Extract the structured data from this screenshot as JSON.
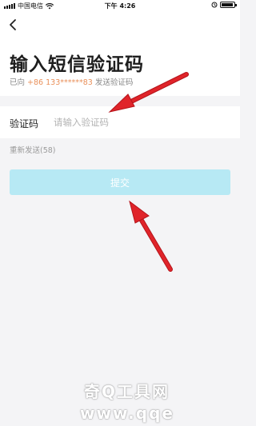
{
  "status_bar": {
    "carrier": "中国电信",
    "time": "下午 4:26"
  },
  "header": {
    "back_icon": "chevron-left-icon",
    "title": "输入短信验证码",
    "subtitle_prefix": "已向",
    "phone": "+86 133******83",
    "subtitle_suffix": "发送验证码"
  },
  "form": {
    "code_label": "验证码",
    "code_placeholder": "请输入验证码",
    "code_value": "",
    "resend_label": "重新发送(58)",
    "submit_label": "提交"
  },
  "watermark": {
    "line1": "奇Q工具网",
    "line2": "www.qqe"
  },
  "colors": {
    "accent_phone": "#e9905a",
    "submit_bg": "#b7e9f4",
    "annotation_arrow": "#e0242a"
  }
}
